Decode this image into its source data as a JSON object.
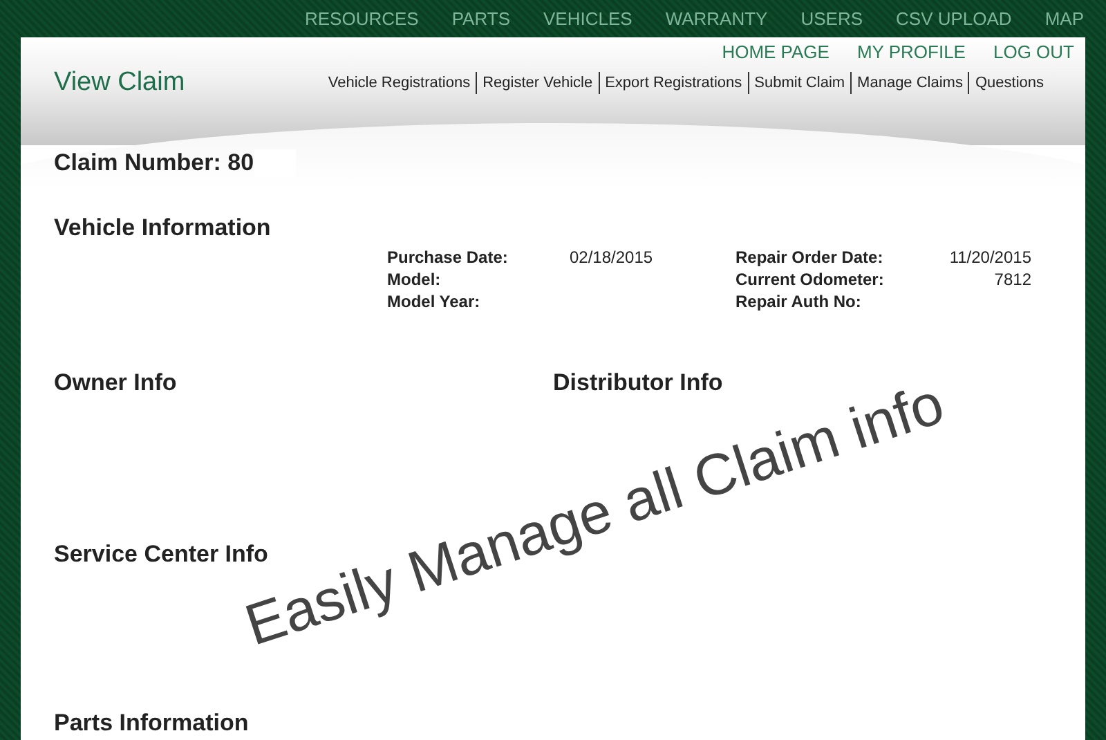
{
  "top_nav": [
    "RESOURCES",
    "PARTS",
    "VEHICLES",
    "WARRANTY",
    "USERS",
    "CSV UPLOAD",
    "MAP"
  ],
  "user_links": [
    "HOME PAGE",
    "MY PROFILE",
    "LOG OUT"
  ],
  "page_title": "View Claim",
  "sub_nav": [
    "Vehicle Registrations",
    "Register Vehicle",
    "Export Registrations",
    "Submit Claim",
    "Manage Claims",
    "Questions"
  ],
  "claim_number": "Claim Number: 80",
  "vehicle_information": {
    "heading": "Vehicle Information",
    "left_fields": [
      {
        "label": "Purchase Date:",
        "value": "02/18/2015"
      },
      {
        "label": "Model:"
      },
      {
        "label": "Model Year:"
      }
    ],
    "right_fields": [
      {
        "label": "Repair Order Date:",
        "value": "11/20/2015"
      },
      {
        "label": "Current Odometer:",
        "value": "7812"
      },
      {
        "label": "Repair Auth No:"
      }
    ]
  },
  "sections": [
    "Owner Info",
    "Distributor Info",
    "Service Center Info",
    "Parts Information"
  ],
  "caption": "Easily Manage all Claim info"
}
